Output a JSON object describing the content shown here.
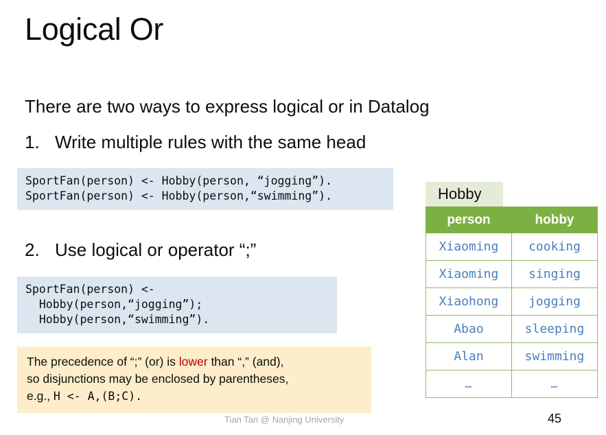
{
  "slide": {
    "title": "Logical Or",
    "lead_line": "There are two ways to express logical or in Datalog",
    "items": [
      {
        "number": "1.",
        "text": "Write multiple rules with the same head"
      },
      {
        "number": "2.",
        "text": "Use logical or operator “;”"
      }
    ],
    "code_blocks": [
      {
        "name": "multiple-rules-code",
        "text": "SportFan(person) <- Hobby(person, “jogging”).\nSportFan(person) <- Hobby(person,“swimming”)."
      },
      {
        "name": "or-operator-code",
        "text": "SportFan(person) <-\n  Hobby(person,“jogging”);\n  Hobby(person,“swimming”)."
      }
    ],
    "note": {
      "line1_a": "The precedence of “;” (or) is ",
      "line1_highlight": "lower",
      "line1_b": " than “,” (and),",
      "line2": "so disjunctions may be enclosed by parentheses,",
      "line3_prefix": "e.g., ",
      "line3_code": "H <- A,(B;C).",
      "highlight_color": "#c00000",
      "background_color": "#fdedca"
    },
    "table": {
      "caption": "Hobby",
      "caption_bg": "#e4ecd7",
      "header_bg": "#7cb043",
      "cell_text_color": "#4a7ebb",
      "columns": [
        "person",
        "hobby"
      ],
      "rows": [
        [
          "Xiaoming",
          "cooking"
        ],
        [
          "Xiaoming",
          "singing"
        ],
        [
          "Xiaohong",
          "jogging"
        ],
        [
          "Abao",
          "sleeping"
        ],
        [
          "Alan",
          "swimming"
        ],
        [
          "…",
          "…"
        ]
      ]
    },
    "footer": {
      "author": "Tian Tan @ Nanjing University",
      "page_number": "45"
    },
    "code_background": "#dce6f1"
  }
}
